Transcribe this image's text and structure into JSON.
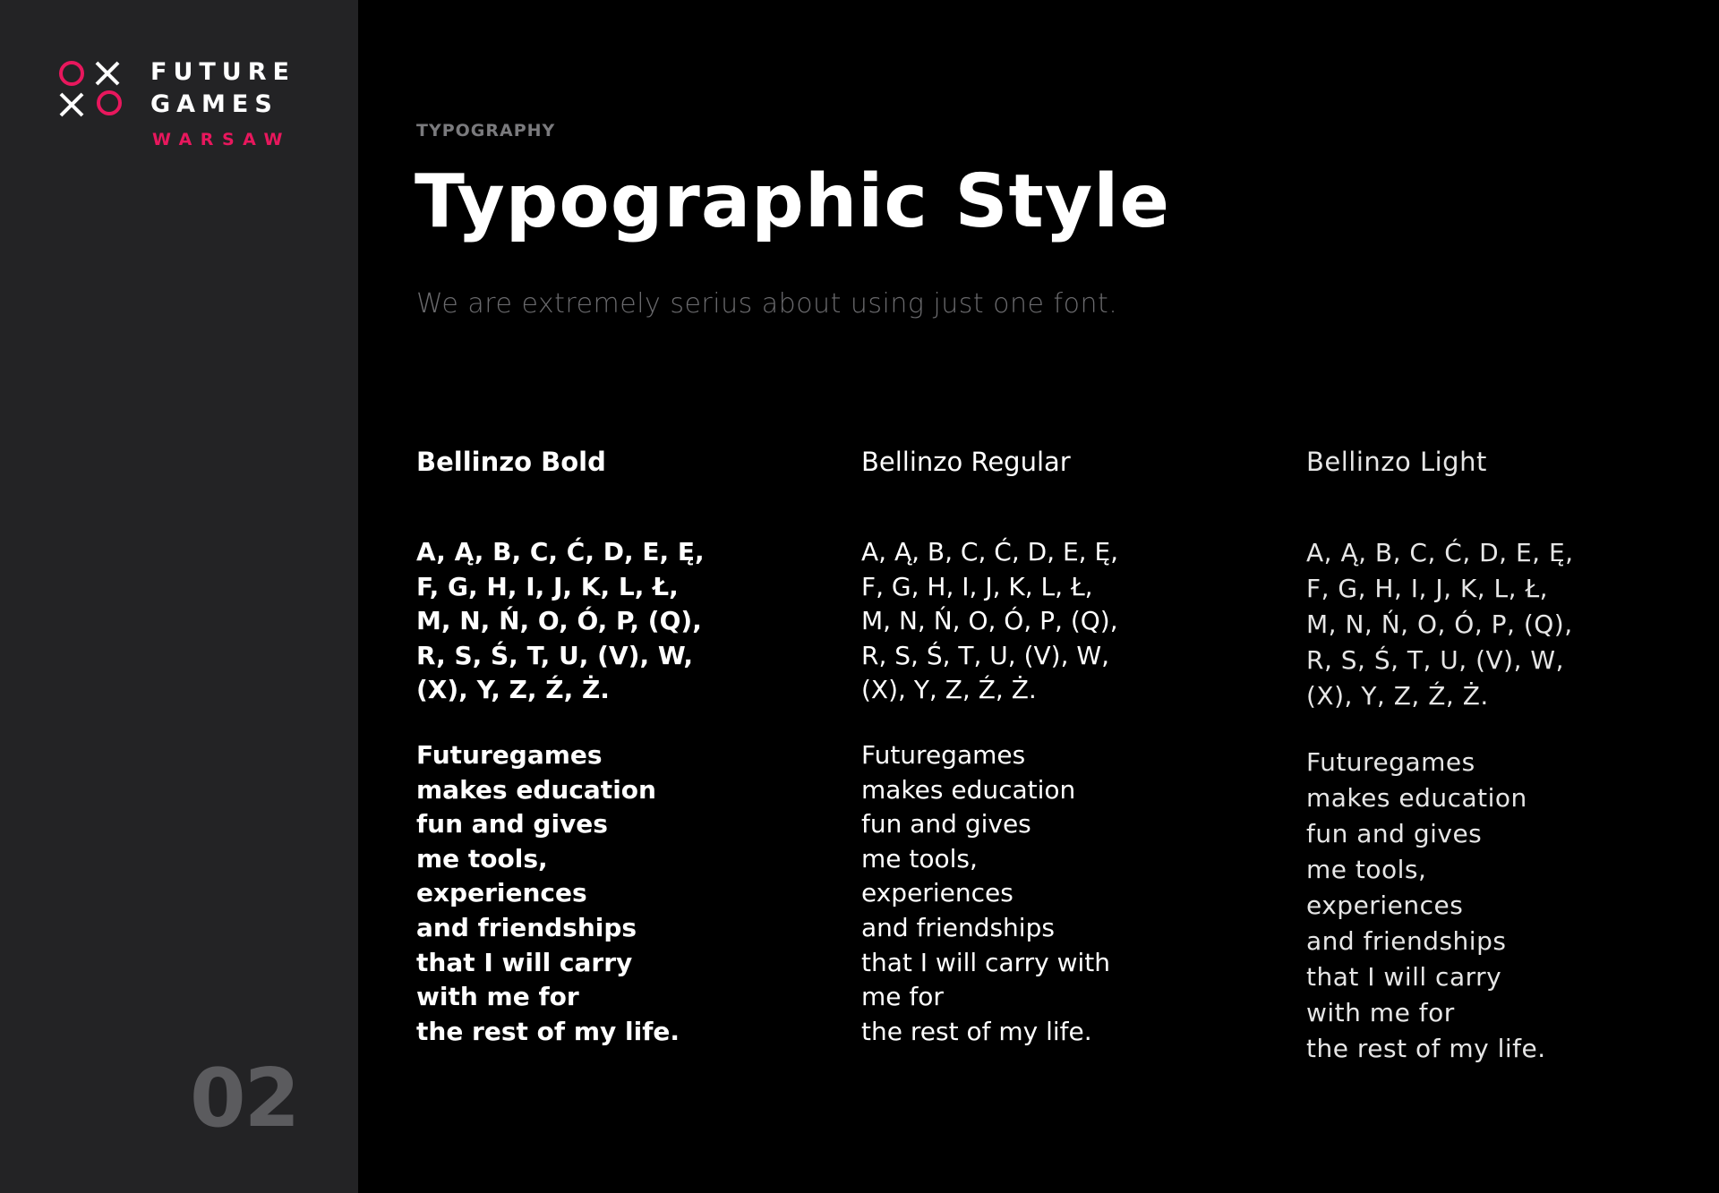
{
  "brand": {
    "line1": "FUTURE",
    "line2": "GAMES",
    "city": "WARSAW",
    "accent_color": "#e8175d",
    "logo_symbols": [
      "o-icon",
      "x-icon",
      "x-icon",
      "o-icon"
    ]
  },
  "page_number": "02",
  "header": {
    "section_label": "TYPOGRAPHY",
    "title": "Typographic Style",
    "subtitle": "We are extremely serius about using just one font."
  },
  "specimens": [
    {
      "font_name": "Bellinzo Bold",
      "alphabet": "A, Ą, B, C, Ć, D, E, Ę,\nF, G, H, I, J, K, L, Ł,\nM, N, Ń, O, Ó, P, (Q),\nR, S, Ś, T, U, (V), W,\n(X), Y, Z, Ź, Ż.",
      "sample": "Futuregames\nmakes education\nfun and gives\nme tools,\nexperiences\nand friendships\nthat I will carry\nwith me for\nthe rest of my life."
    },
    {
      "font_name": "Bellinzo Regular",
      "alphabet": "A, Ą, B, C, Ć, D, E, Ę,\nF, G, H, I, J, K, L, Ł,\nM, N, Ń, O, Ó, P, (Q),\nR, S, Ś, T, U, (V), W,\n(X), Y, Z, Ź, Ż.",
      "sample": "Futuregames\nmakes education\nfun and gives\nme tools,\nexperiences\nand friendships\nthat I will carry with\nme for\nthe rest of my life."
    },
    {
      "font_name": "Bellinzo Light",
      "alphabet": "A, Ą, B, C, Ć, D, E, Ę,\nF, G, H, I, J, K, L, Ł,\nM, N, Ń, O, Ó, P, (Q),\nR, S, Ś, T, U, (V), W,\n(X), Y, Z, Ź, Ż.",
      "sample": "Futuregames\nmakes education\nfun and gives\nme tools,\nexperiences\nand friendships\nthat I will carry\nwith me for\nthe rest of my life."
    }
  ]
}
